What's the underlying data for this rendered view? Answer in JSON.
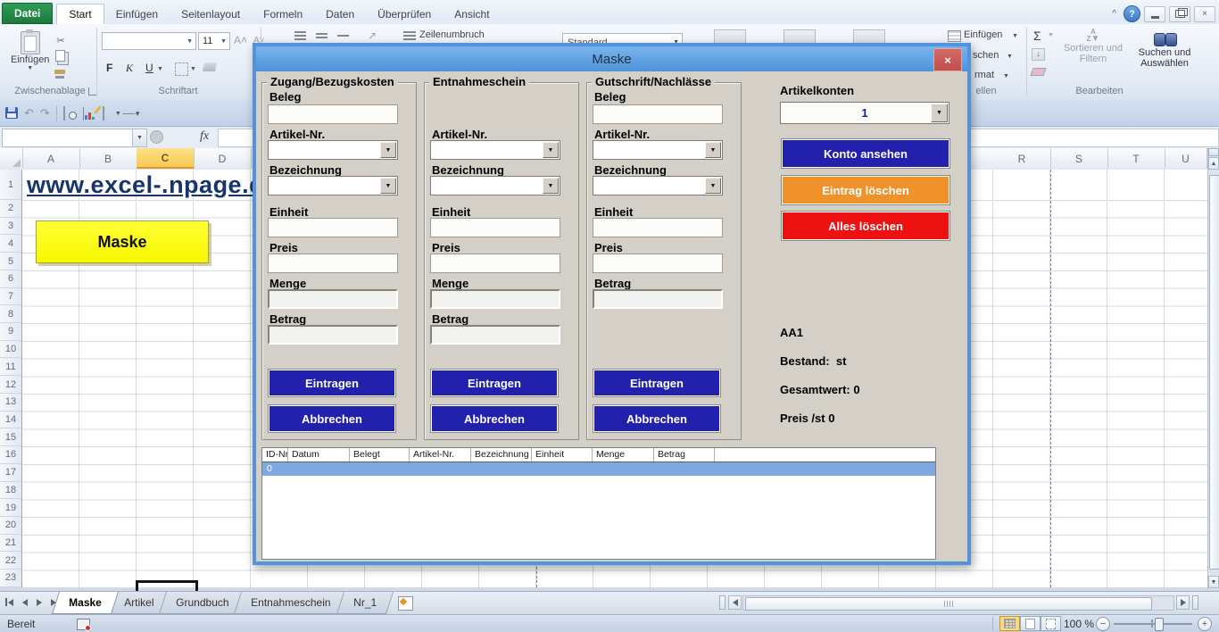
{
  "icons": {
    "dropdown": "▼",
    "close": "×",
    "help": "?",
    "collapse": "^",
    "scissors": "✂",
    "undo": "↶",
    "redo": "↷",
    "orientation": "↗",
    "sigma": "Σ",
    "arrow_down": "↓",
    "left": "◀",
    "right": "▶",
    "up": "▲",
    "down": "▼",
    "minus": "−",
    "plus": "+",
    "az": "A Z"
  },
  "ribbon": {
    "file_tab": "Datei",
    "tabs": [
      "Start",
      "Einfügen",
      "Seitenlayout",
      "Formeln",
      "Daten",
      "Überprüfen",
      "Ansicht"
    ],
    "paste_button": "Einfügen",
    "clipboard_group": "Zwischenablage",
    "font_group": "Schriftart",
    "font_size": "11",
    "bold": "F",
    "italic": "K",
    "underline": "U",
    "wrap_text": "Zeilenumbruch",
    "number_format": "Standard",
    "cells_insert": "Einfügen",
    "cells_delete_fragment": "schen",
    "cells_format_fragment": "rmat",
    "cells_group_fragment": "ellen",
    "sort_filter": "Sortieren und Filtern",
    "find_select": "Suchen und Auswählen",
    "editing_group": "Bearbeiten"
  },
  "formula_bar": {
    "name_box": "",
    "fx": "fx"
  },
  "sheet": {
    "link_text": "www.excel-.npage.de",
    "maske_button": "Maske",
    "col_headers_left": [
      "A",
      "B",
      "C",
      "D"
    ],
    "col_headers_right": [
      "R",
      "S",
      "T",
      "U"
    ],
    "selected_col": "C",
    "row_numbers": [
      "1",
      "2",
      "3",
      "4",
      "5",
      "6",
      "7",
      "8",
      "9",
      "10",
      "11",
      "12",
      "13",
      "14",
      "15",
      "16",
      "17",
      "18",
      "19",
      "20",
      "21",
      "22",
      "23"
    ]
  },
  "dialog": {
    "title": "Maske",
    "frames": [
      {
        "caption": "Zugang/Bezugskosten",
        "beleg": "Beleg",
        "artikel": "Artikel-Nr.",
        "bezeichnung": "Bezeichnung",
        "einheit": "Einheit",
        "preis": "Preis",
        "menge": "Menge",
        "betrag": "Betrag",
        "submit": "Eintragen",
        "cancel": "Abbrechen"
      },
      {
        "caption": "Entnahmeschein",
        "artikel": "Artikel-Nr.",
        "bezeichnung": "Bezeichnung",
        "einheit": "Einheit",
        "preis": "Preis",
        "menge": "Menge",
        "betrag": "Betrag",
        "submit": "Eintragen",
        "cancel": "Abbrechen"
      },
      {
        "caption": "Gutschrift/Nachlässe",
        "beleg": "Beleg",
        "artikel": "Artikel-Nr.",
        "bezeichnung": "Bezeichnung",
        "einheit": "Einheit",
        "preis": "Preis",
        "betrag": "Betrag",
        "submit": "Eintragen",
        "cancel": "Abbrechen"
      }
    ],
    "accounts": {
      "label": "Artikelkonten",
      "value": "1",
      "view_button": "Konto ansehen",
      "delete_entry_button": "Eintrag löschen",
      "delete_all_button": "Alles löschen"
    },
    "info": {
      "article": "AA1",
      "bestand": "Bestand:  st",
      "gesamtwert": "Gesamtwert: 0",
      "preis": "Preis /st 0"
    },
    "list": {
      "headers": [
        "ID-Nr.",
        "Datum",
        "Belegt",
        "Artikel-Nr.",
        "Bezeichnung",
        "Einheit",
        "Menge",
        "Betrag"
      ],
      "selected_id": "0"
    }
  },
  "sheet_tabs": [
    "Maske",
    "Artikel",
    "Grundbuch",
    "Entnahmeschein",
    "Nr_1"
  ],
  "active_sheet_tab": "Maske",
  "status_bar": {
    "ready": "Bereit",
    "zoom": "100 %"
  },
  "colors": {
    "dialog_frame": "#4f94dd",
    "title_bar": "#5c9fe3",
    "navy_button": "#2121ae",
    "orange_button": "#f0922c",
    "red_button": "#ee1111",
    "close_button": "#c75050",
    "selected_row": "#7fa8e0",
    "maske_button_bg": "#ffff00",
    "selected_column_header": "#f9d36a"
  }
}
